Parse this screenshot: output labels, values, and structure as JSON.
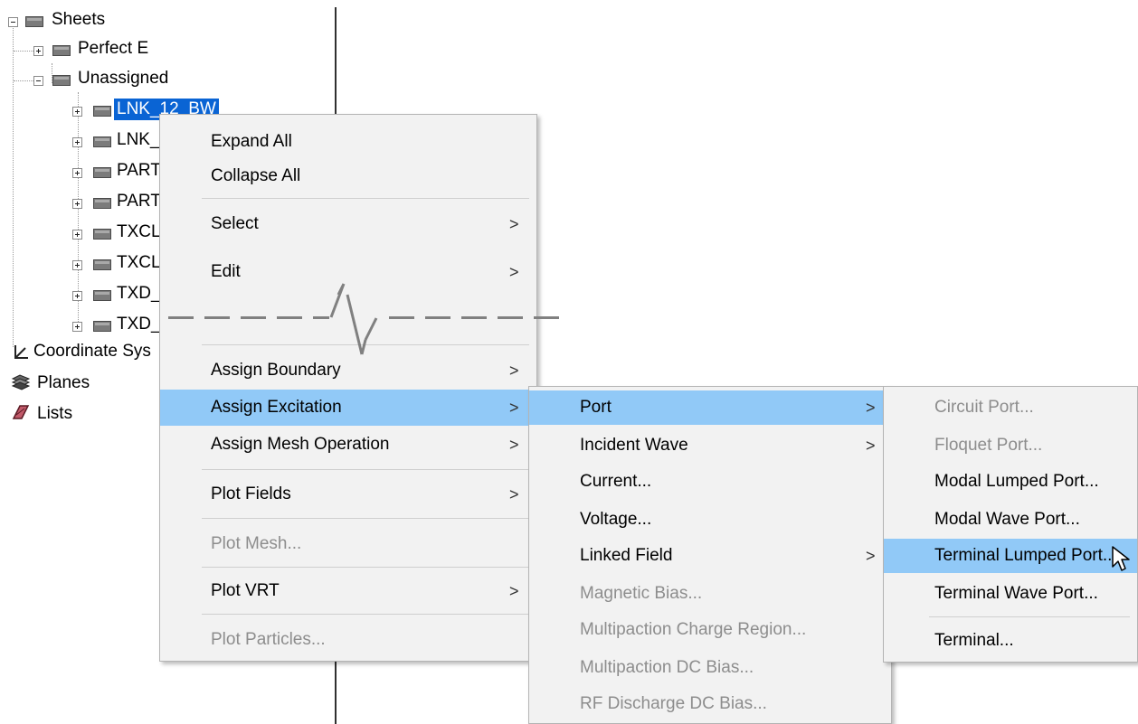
{
  "tree": {
    "sheets": "Sheets",
    "perfect_e": "Perfect E",
    "unassigned": "Unassigned",
    "items": [
      "LNK_12_BW",
      "LNK_",
      "PART",
      "PART",
      "TXCL",
      "TXCL",
      "TXD_",
      "TXD_"
    ],
    "coordinate_systems": "Coordinate Sys",
    "planes": "Planes",
    "lists": "Lists"
  },
  "context_menu": {
    "expand_all": "Expand All",
    "collapse_all": "Collapse All",
    "select": "Select",
    "edit": "Edit",
    "assign_boundary": "Assign Boundary",
    "assign_excitation": "Assign Excitation",
    "assign_mesh_operation": "Assign Mesh Operation",
    "plot_fields": "Plot Fields",
    "plot_mesh": "Plot Mesh...",
    "plot_vrt": "Plot VRT",
    "plot_particles": "Plot Particles..."
  },
  "excitation_menu": {
    "port": "Port",
    "incident_wave": "Incident Wave",
    "current": "Current...",
    "voltage": "Voltage...",
    "linked_field": "Linked Field",
    "magnetic_bias": "Magnetic Bias...",
    "multipaction_charge_region": "Multipaction Charge Region...",
    "multipaction_dc_bias": "Multipaction DC Bias...",
    "rf_discharge_dc_bias": "RF Discharge DC Bias..."
  },
  "port_menu": {
    "circuit_port": "Circuit Port...",
    "floquet_port": "Floquet Port...",
    "modal_lumped_port": "Modal Lumped Port...",
    "modal_wave_port": "Modal Wave Port...",
    "terminal_lumped_port": "Terminal Lumped Port...",
    "terminal_wave_port": "Terminal Wave Port...",
    "terminal": "Terminal..."
  },
  "submenu_arrow": ">",
  "colors": {
    "highlight": "#91c9f7",
    "selection": "#0a64d4",
    "menu_bg": "#f2f2f2",
    "disabled_text": "#8d8d8d"
  }
}
